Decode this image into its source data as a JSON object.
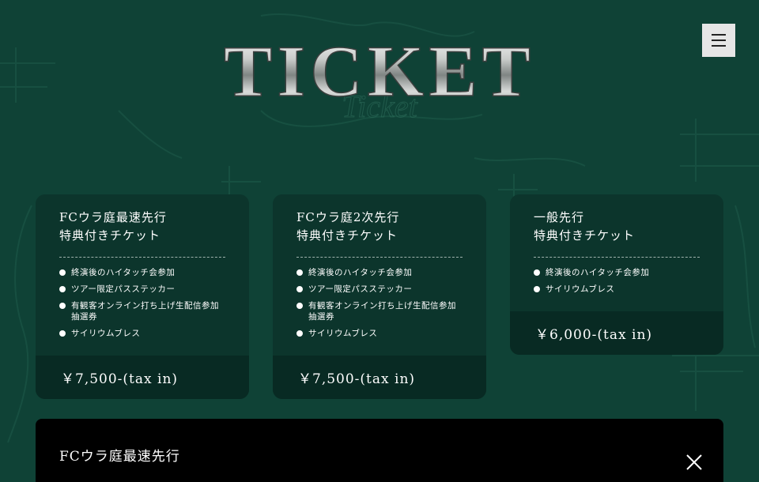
{
  "page": {
    "title": "TICKET",
    "background_color": "#0f4236",
    "card_color": "#0c352c",
    "price_bar_color": "#082a23"
  },
  "header": {
    "menu_icon": "hamburger-menu-icon"
  },
  "tickets": [
    {
      "title_line1": "FCウラ庭最速先行",
      "title_line2": "特典付きチケット",
      "benefits": [
        "終演後のハイタッチ会参加",
        "ツアー限定パスステッカー",
        "有観客オンライン打ち上げ生配信参加抽選券",
        "サイリウムブレス"
      ],
      "price": "￥7,500-(tax in)"
    },
    {
      "title_line1": "FCウラ庭2次先行",
      "title_line2": "特典付きチケット",
      "benefits": [
        "終演後のハイタッチ会参加",
        "ツアー限定パスステッカー",
        "有観客オンライン打ち上げ生配信参加抽選券",
        "サイリウムブレス"
      ],
      "price": "￥7,500-(tax in)"
    },
    {
      "title_line1": "一般先行",
      "title_line2": "特典付きチケット",
      "benefits": [
        "終演後のハイタッチ会参加",
        "サイリウムブレス"
      ],
      "price": "￥6,000-(tax in)"
    }
  ],
  "detail": {
    "title": "FCウラ庭最速先行",
    "close_icon": "close-icon"
  }
}
